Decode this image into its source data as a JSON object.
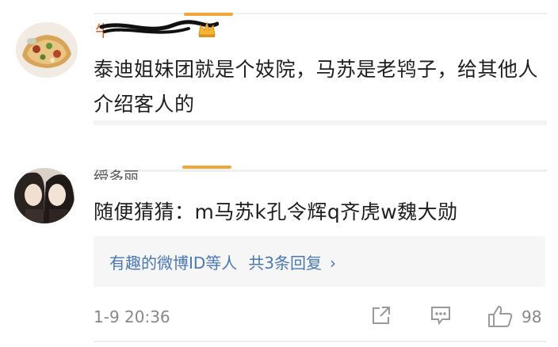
{
  "comment1": {
    "username": "牛···",
    "text": "泰迪姐妹团就是个妓院，马苏是老鸨子，给其他人介绍客人的"
  },
  "comment2": {
    "username": "绶多丽",
    "text": "随便猜猜：m马苏k孔令辉q齐虎w魏大勋",
    "replies": {
      "prefix": "有趣的微博ID等人",
      "count": "共3条回复",
      "chevron": "›"
    },
    "timestamp": "1-9 20:36",
    "like_count": "98"
  },
  "colors": {
    "accent": "#f2a63a",
    "link": "#4b78b5",
    "meta": "#888888"
  },
  "icons": [
    "crown-icon",
    "share-icon",
    "comment-icon",
    "like-icon"
  ]
}
